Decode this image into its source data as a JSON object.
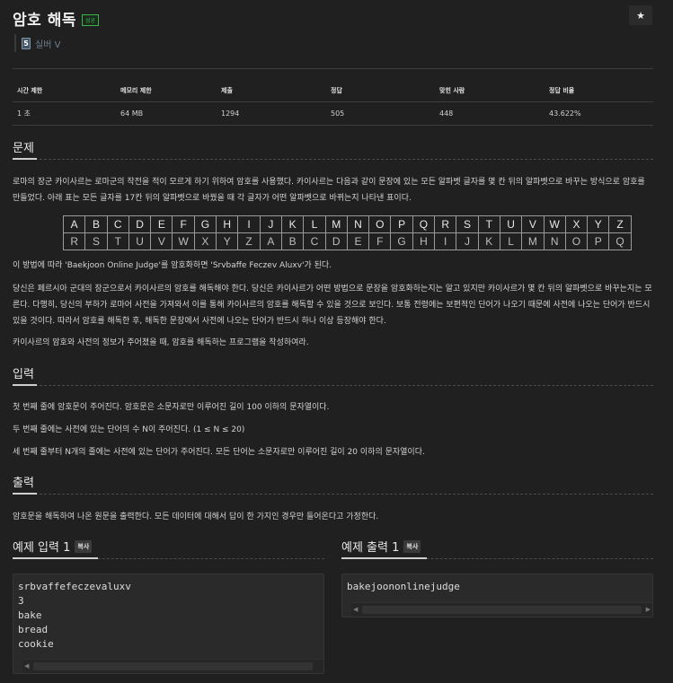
{
  "header": {
    "title": "암호 해독",
    "badge": "성공",
    "star_icon": "★",
    "tier_number": "5",
    "tier_label": "실버 V"
  },
  "stats": {
    "headers": [
      "시간 제한",
      "메모리 제한",
      "제출",
      "정답",
      "맞힌 사람",
      "정답 비율"
    ],
    "values": [
      "1 초",
      "64 MB",
      "1294",
      "505",
      "448",
      "43.622%"
    ]
  },
  "problem": {
    "title": "문제",
    "p1": "로마의 장군 카이사르는 로마군의 작전을 적이 모르게 하기 위하여 암호를 사용했다. 카이사르는 다음과 같이 문장에 있는 모든 알파벳 글자를 몇 칸 뒤의 알파벳으로 바꾸는 방식으로 암호를 만들었다. 아래 표는 모든 글자를 17칸 뒤의 알파벳으로 바꿨을 때 각 글자가 어떤 알파벳으로 바뀌는지 나타낸 표이다.",
    "cipher_top": [
      "A",
      "B",
      "C",
      "D",
      "E",
      "F",
      "G",
      "H",
      "I",
      "J",
      "K",
      "L",
      "M",
      "N",
      "O",
      "P",
      "Q",
      "R",
      "S",
      "T",
      "U",
      "V",
      "W",
      "X",
      "Y",
      "Z"
    ],
    "cipher_bottom": [
      "R",
      "S",
      "T",
      "U",
      "V",
      "W",
      "X",
      "Y",
      "Z",
      "A",
      "B",
      "C",
      "D",
      "E",
      "F",
      "G",
      "H",
      "I",
      "J",
      "K",
      "L",
      "M",
      "N",
      "O",
      "P",
      "Q"
    ],
    "p2": "이 방법에 따라 'Baekjoon Online Judge'를 암호화하면 'Srvbaffe Feczev Aluxv'가 된다.",
    "p3": "당신은 페르시아 군대의 장군으로서 카이사르의 암호를 해독해야 한다. 당신은 카이사르가 어떤 방법으로 문장을 암호화하는지는 알고 있지만 카이사르가 몇 칸 뒤의 알파벳으로 바꾸는지는 모른다. 다행히, 당신의 부하가 로마어 사전을 가져와서 이를 통해 카이사르의 암호를 해독할 수 있을 것으로 보인다. 보통 전령에는 보편적인 단어가 나오기 때문에 사전에 나오는 단어가 반드시 있을 것이다. 따라서 암호를 해독한 후, 해독한 문장에서 사전에 나오는 단어가 반드시 하나 이상 등장해야 한다.",
    "p4": "카이사르의 암호와 사전의 정보가 주어졌을 때, 암호를 해독하는 프로그램을 작성하여라."
  },
  "input": {
    "title": "입력",
    "p1": "첫 번째 줄에 암호문이 주어진다. 암호문은 소문자로만 이루어진 길이 100 이하의 문자열이다.",
    "p2": "두 번째 줄에는 사전에 있는 단어의 수 N이 주어진다. (1 ≤ N ≤ 20)",
    "p3": "세 번째 줄부터 N개의 줄에는 사전에 있는 단어가 주어진다. 모든 단어는 소문자로만 이루어진 길이 20 이하의 문자열이다."
  },
  "output": {
    "title": "출력",
    "p1": "암호문을 해독하여 나온 원문을 출력한다. 모든 데이터에 대해서 답이 한 가지인 경우만 들어온다고 가정한다."
  },
  "examples": {
    "input_title": "예제 입력 1",
    "output_title": "예제 출력 1",
    "copy_label": "복사",
    "input_text": "srbvaffefeczevaluxv\n3\nbake\nbread\ncookie",
    "output_text": "bakejoononlinejudge",
    "scroll_left": "◀",
    "scroll_right": "▶"
  }
}
